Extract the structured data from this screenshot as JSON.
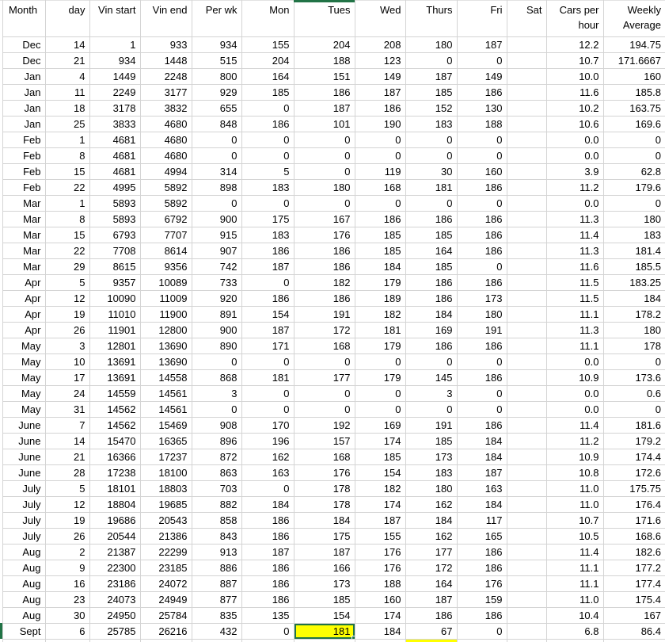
{
  "sheet": {
    "columns": [
      "Month",
      "day",
      "Vin start",
      "Vin end",
      "Per wk",
      "Mon",
      "Tues",
      "Wed",
      "Thurs",
      "Fri",
      "Sat",
      "Cars per hour",
      "Weekly Average"
    ],
    "rows": [
      [
        "Dec",
        "14",
        "1",
        "933",
        "934",
        "155",
        "204",
        "208",
        "180",
        "187",
        "",
        "12.2",
        "194.75"
      ],
      [
        "Dec",
        "21",
        "934",
        "1448",
        "515",
        "204",
        "188",
        "123",
        "0",
        "0",
        "",
        "10.7",
        "171.6667"
      ],
      [
        "Jan",
        "4",
        "1449",
        "2248",
        "800",
        "164",
        "151",
        "149",
        "187",
        "149",
        "",
        "10.0",
        "160"
      ],
      [
        "Jan",
        "11",
        "2249",
        "3177",
        "929",
        "185",
        "186",
        "187",
        "185",
        "186",
        "",
        "11.6",
        "185.8"
      ],
      [
        "Jan",
        "18",
        "3178",
        "3832",
        "655",
        "0",
        "187",
        "186",
        "152",
        "130",
        "",
        "10.2",
        "163.75"
      ],
      [
        "Jan",
        "25",
        "3833",
        "4680",
        "848",
        "186",
        "101",
        "190",
        "183",
        "188",
        "",
        "10.6",
        "169.6"
      ],
      [
        "Feb",
        "1",
        "4681",
        "4680",
        "0",
        "0",
        "0",
        "0",
        "0",
        "0",
        "",
        "0.0",
        "0"
      ],
      [
        "Feb",
        "8",
        "4681",
        "4680",
        "0",
        "0",
        "0",
        "0",
        "0",
        "0",
        "",
        "0.0",
        "0"
      ],
      [
        "Feb",
        "15",
        "4681",
        "4994",
        "314",
        "5",
        "0",
        "119",
        "30",
        "160",
        "",
        "3.9",
        "62.8"
      ],
      [
        "Feb",
        "22",
        "4995",
        "5892",
        "898",
        "183",
        "180",
        "168",
        "181",
        "186",
        "",
        "11.2",
        "179.6"
      ],
      [
        "Mar",
        "1",
        "5893",
        "5892",
        "0",
        "0",
        "0",
        "0",
        "0",
        "0",
        "",
        "0.0",
        "0"
      ],
      [
        "Mar",
        "8",
        "5893",
        "6792",
        "900",
        "175",
        "167",
        "186",
        "186",
        "186",
        "",
        "11.3",
        "180"
      ],
      [
        "Mar",
        "15",
        "6793",
        "7707",
        "915",
        "183",
        "176",
        "185",
        "185",
        "186",
        "",
        "11.4",
        "183"
      ],
      [
        "Mar",
        "22",
        "7708",
        "8614",
        "907",
        "186",
        "186",
        "185",
        "164",
        "186",
        "",
        "11.3",
        "181.4"
      ],
      [
        "Mar",
        "29",
        "8615",
        "9356",
        "742",
        "187",
        "186",
        "184",
        "185",
        "0",
        "",
        "11.6",
        "185.5"
      ],
      [
        "Apr",
        "5",
        "9357",
        "10089",
        "733",
        "0",
        "182",
        "179",
        "186",
        "186",
        "",
        "11.5",
        "183.25"
      ],
      [
        "Apr",
        "12",
        "10090",
        "11009",
        "920",
        "186",
        "186",
        "189",
        "186",
        "173",
        "",
        "11.5",
        "184"
      ],
      [
        "Apr",
        "19",
        "11010",
        "11900",
        "891",
        "154",
        "191",
        "182",
        "184",
        "180",
        "",
        "11.1",
        "178.2"
      ],
      [
        "Apr",
        "26",
        "11901",
        "12800",
        "900",
        "187",
        "172",
        "181",
        "169",
        "191",
        "",
        "11.3",
        "180"
      ],
      [
        "May",
        "3",
        "12801",
        "13690",
        "890",
        "171",
        "168",
        "179",
        "186",
        "186",
        "",
        "11.1",
        "178"
      ],
      [
        "May",
        "10",
        "13691",
        "13690",
        "0",
        "0",
        "0",
        "0",
        "0",
        "0",
        "",
        "0.0",
        "0"
      ],
      [
        "May",
        "17",
        "13691",
        "14558",
        "868",
        "181",
        "177",
        "179",
        "145",
        "186",
        "",
        "10.9",
        "173.6"
      ],
      [
        "May",
        "24",
        "14559",
        "14561",
        "3",
        "0",
        "0",
        "0",
        "3",
        "0",
        "",
        "0.0",
        "0.6"
      ],
      [
        "May",
        "31",
        "14562",
        "14561",
        "0",
        "0",
        "0",
        "0",
        "0",
        "0",
        "",
        "0.0",
        "0"
      ],
      [
        "June",
        "7",
        "14562",
        "15469",
        "908",
        "170",
        "192",
        "169",
        "191",
        "186",
        "",
        "11.4",
        "181.6"
      ],
      [
        "June",
        "14",
        "15470",
        "16365",
        "896",
        "196",
        "157",
        "174",
        "185",
        "184",
        "",
        "11.2",
        "179.2"
      ],
      [
        "June",
        "21",
        "16366",
        "17237",
        "872",
        "162",
        "168",
        "185",
        "173",
        "184",
        "",
        "10.9",
        "174.4"
      ],
      [
        "June",
        "28",
        "17238",
        "18100",
        "863",
        "163",
        "176",
        "154",
        "183",
        "187",
        "",
        "10.8",
        "172.6"
      ],
      [
        "July",
        "5",
        "18101",
        "18803",
        "703",
        "0",
        "178",
        "182",
        "180",
        "163",
        "",
        "11.0",
        "175.75"
      ],
      [
        "July",
        "12",
        "18804",
        "19685",
        "882",
        "184",
        "178",
        "174",
        "162",
        "184",
        "",
        "11.0",
        "176.4"
      ],
      [
        "July",
        "19",
        "19686",
        "20543",
        "858",
        "186",
        "184",
        "187",
        "184",
        "117",
        "",
        "10.7",
        "171.6"
      ],
      [
        "July",
        "26",
        "20544",
        "21386",
        "843",
        "186",
        "175",
        "155",
        "162",
        "165",
        "",
        "10.5",
        "168.6"
      ],
      [
        "Aug",
        "2",
        "21387",
        "22299",
        "913",
        "187",
        "187",
        "176",
        "177",
        "186",
        "",
        "11.4",
        "182.6"
      ],
      [
        "Aug",
        "9",
        "22300",
        "23185",
        "886",
        "186",
        "166",
        "176",
        "172",
        "186",
        "",
        "11.1",
        "177.2"
      ],
      [
        "Aug",
        "16",
        "23186",
        "24072",
        "887",
        "186",
        "173",
        "188",
        "164",
        "176",
        "",
        "11.1",
        "177.4"
      ],
      [
        "Aug",
        "23",
        "24073",
        "24949",
        "877",
        "186",
        "185",
        "160",
        "187",
        "159",
        "",
        "11.0",
        "175.4"
      ],
      [
        "Aug",
        "30",
        "24950",
        "25784",
        "835",
        "135",
        "154",
        "174",
        "186",
        "186",
        "",
        "10.4",
        "167"
      ],
      [
        "Sept",
        "6",
        "25785",
        "26216",
        "432",
        "0",
        "181",
        "184",
        "67",
        "0",
        "",
        "6.8",
        "86.4"
      ]
    ],
    "selection": {
      "row_index": 37,
      "column_index": 6,
      "column_label": "Tues",
      "value": "181",
      "fill_color": "#ffff00",
      "border_color": "#217346"
    },
    "partial_next_row": {
      "highlight_column_index": 8,
      "highlight_column_label": "Thurs",
      "highlight_color": "#ffff00"
    },
    "colors": {
      "gridline": "#d4d4d4",
      "selection_green": "#217346",
      "highlight_yellow": "#ffff00",
      "background": "#ffffff",
      "text": "#000000"
    }
  }
}
